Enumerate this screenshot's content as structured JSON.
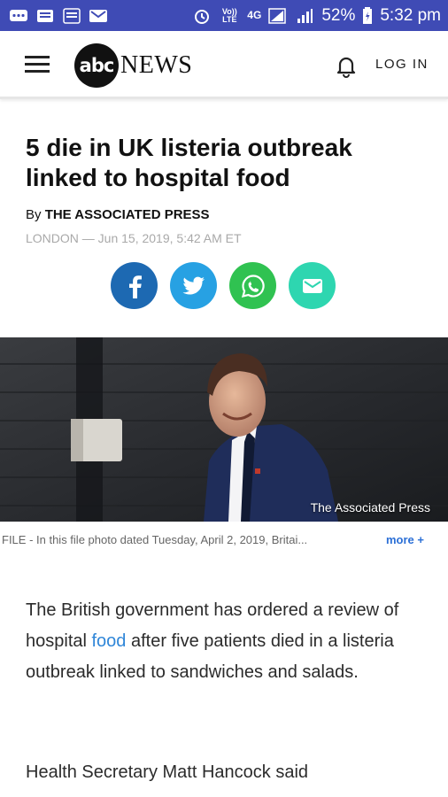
{
  "status_bar": {
    "time": "5:32 pm",
    "battery": "52%",
    "volte": "Vo)) LTE",
    "network": "4G",
    "icons": [
      "messages-icon",
      "news-icon",
      "app-icon",
      "mail-icon",
      "alarm-icon",
      "volte-icon",
      "4g-icon",
      "signal-icon",
      "battery-icon"
    ]
  },
  "header": {
    "logo_mark": "abc",
    "logo_text": "NEWS",
    "login_label": "LOG IN"
  },
  "article": {
    "headline": "5 die in UK listeria outbreak linked to hospital food",
    "byline_prefix": "By ",
    "byline_author": "THE ASSOCIATED PRESS",
    "dateline": "LONDON — Jun 15, 2019, 5:42 AM ET",
    "share_buttons": [
      "facebook",
      "twitter",
      "whatsapp",
      "email"
    ],
    "photo_credit": "The Associated Press",
    "caption": "FILE - In this file photo dated Tuesday, April 2, 2019, Britai...",
    "more_label": "more +",
    "para1_before": "The British government has ordered a review of hospital ",
    "para1_link": "food",
    "para1_after": " after five patients died in a listeria outbreak linked to sandwiches and salads.",
    "para2": "Health Secretary Matt Hancock said"
  },
  "colors": {
    "status_bar": "#3f4bb5",
    "facebook": "#1d69b2",
    "twitter": "#27a1e3",
    "whatsapp": "#30c251",
    "email": "#2ed6b0",
    "link": "#2f86d8"
  }
}
